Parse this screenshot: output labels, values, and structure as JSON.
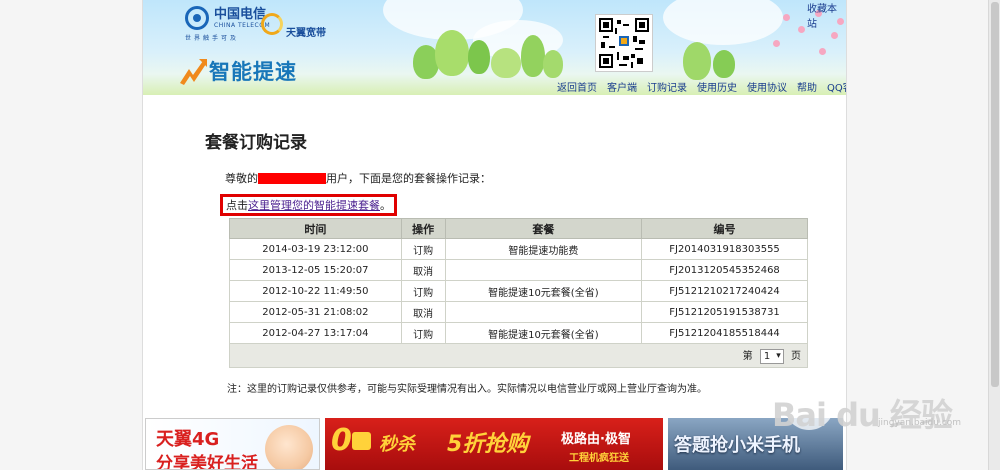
{
  "header": {
    "telecom_name": "中国电信",
    "telecom_name_en": "CHINA TELECOM",
    "slogan": "世界触手可及",
    "tianyi_label": "天翼宽带",
    "brand_title": "智能提速",
    "favorite_link": "收藏本站",
    "nav": [
      "返回首页",
      "客户端",
      "订购记录",
      "使用历史",
      "使用协议",
      "帮助",
      "QQ客服"
    ]
  },
  "main": {
    "title": "套餐订购记录",
    "greeting_prefix": "尊敬的",
    "greeting_suffix": "用户，下面是您的套餐操作记录：",
    "manage_prefix": "点击",
    "manage_link": "这里管理您的智能提速套餐",
    "manage_suffix": "。"
  },
  "table": {
    "headers": [
      "时间",
      "操作",
      "套餐",
      "编号"
    ],
    "rows": [
      [
        "2014-03-19 23:12:00",
        "订购",
        "智能提速功能费",
        "FJ20140319183035​55"
      ],
      [
        "2013-12-05 15:20:07",
        "取消",
        "",
        "FJ2013120545352468"
      ],
      [
        "2012-10-22 11:49:50",
        "订购",
        "智能提速10元套餐(全省)",
        "FJ5121210217240424"
      ],
      [
        "2012-05-31 21:08:02",
        "取消",
        "",
        "FJ5121205191538731"
      ],
      [
        "2012-04-27 13:17:04",
        "订购",
        "智能提速10元套餐(全省)",
        "FJ5121204185518444"
      ]
    ],
    "pager_prefix": "第",
    "pager_value": "1",
    "pager_suffix": "页"
  },
  "note": "注：这里的订购记录仅供参考，可能与实际受理情况有出入。实际情况以电信营业厅或网上营业厅查询为准。",
  "banners": {
    "b1_line1": "天翼4G",
    "b1_line2": "分享美好生活",
    "b2_zero": "0",
    "b2_seckill": "秒杀",
    "b2_half": "5折抢购",
    "b2_tag": "极路由·极智",
    "b2_tag2": "工程机疯狂送",
    "b3_text": "答题抢小米手机"
  },
  "watermark": {
    "text": "Bai du 经验",
    "url": "jingyan.baidu.com"
  }
}
